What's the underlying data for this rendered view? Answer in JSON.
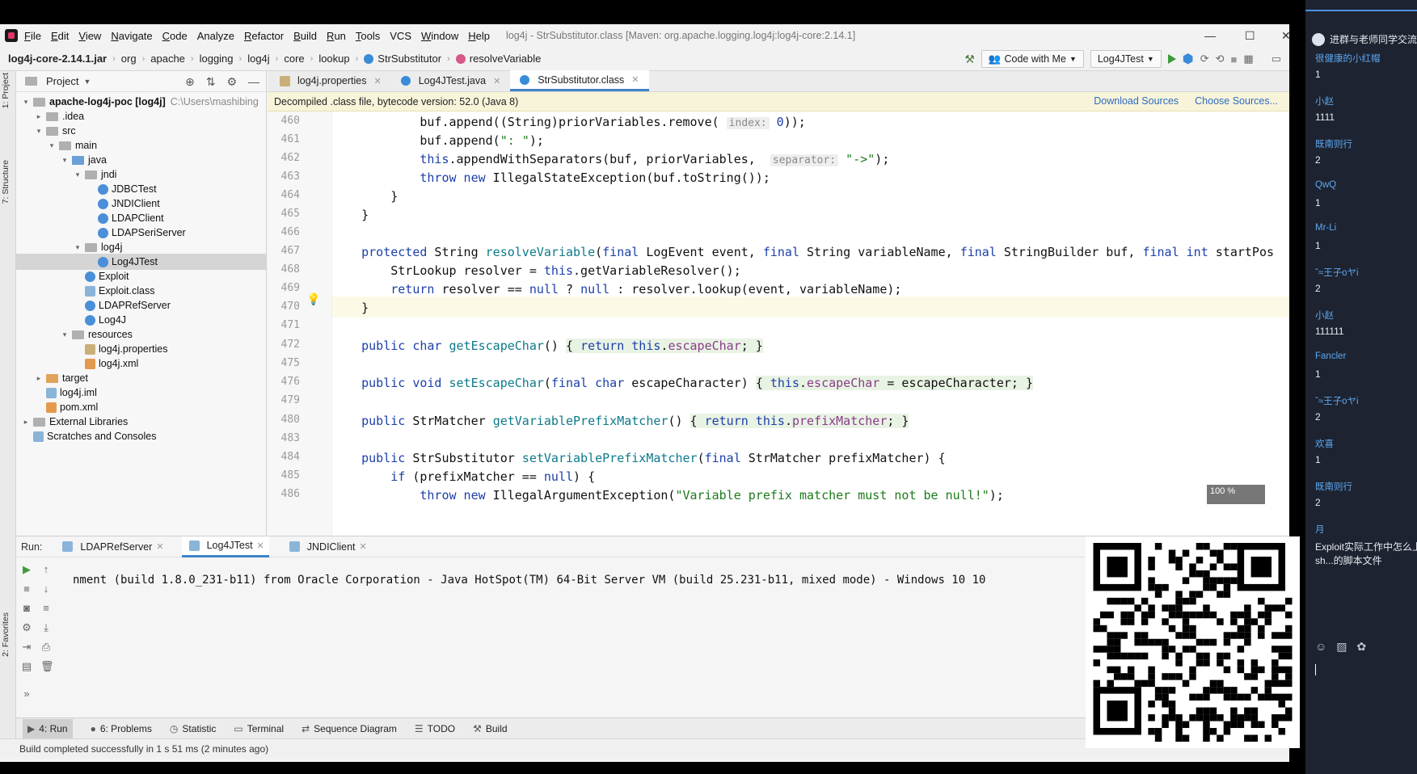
{
  "menu": {
    "items": [
      {
        "u": "F",
        "rest": "ile"
      },
      {
        "u": "E",
        "rest": "dit"
      },
      {
        "u": "V",
        "rest": "iew"
      },
      {
        "u": "N",
        "rest": "avigate"
      },
      {
        "u": "C",
        "rest": "ode"
      },
      {
        "u": "",
        "rest": "Analyze"
      },
      {
        "u": "R",
        "rest": "efactor"
      },
      {
        "u": "B",
        "rest": "uild"
      },
      {
        "u": "R",
        "rest": "un"
      },
      {
        "u": "T",
        "rest": "ools"
      },
      {
        "u": "",
        "rest": "VCS"
      },
      {
        "u": "W",
        "rest": "indow"
      },
      {
        "u": "H",
        "rest": "elp"
      }
    ],
    "window_title": "log4j - StrSubstitutor.class [Maven: org.apache.logging.log4j:log4j-core:2.14.1]"
  },
  "nav": {
    "crumbs": [
      "log4j-core-2.14.1.jar",
      "org",
      "apache",
      "logging",
      "log4j",
      "core",
      "lookup",
      "StrSubstitutor",
      "resolveVariable"
    ],
    "code_with_me": "Code with Me",
    "run_config": "Log4JTest"
  },
  "sidebar_tabs": {
    "project": "1: Project",
    "structure": "7: Structure",
    "favorites": "2: Favorites"
  },
  "project": {
    "title": "Project",
    "tree": [
      {
        "label": "apache-log4j-poc [log4j]",
        "extra": "C:\\Users\\mashibing",
        "indent": 0,
        "twisty": "▾",
        "icon": "fold gray",
        "bold": true
      },
      {
        "label": ".idea",
        "extra": "",
        "indent": 1,
        "twisty": "▸",
        "icon": "fold gray"
      },
      {
        "label": "src",
        "extra": "",
        "indent": 1,
        "twisty": "▾",
        "icon": "fold gray"
      },
      {
        "label": "main",
        "extra": "",
        "indent": 2,
        "twisty": "▾",
        "icon": "fold gray"
      },
      {
        "label": "java",
        "extra": "",
        "indent": 3,
        "twisty": "▾",
        "icon": "fold blue"
      },
      {
        "label": "jndi",
        "extra": "",
        "indent": 4,
        "twisty": "▾",
        "icon": "fold gray"
      },
      {
        "label": "JDBCTest",
        "extra": "",
        "indent": 5,
        "twisty": "",
        "icon": "ficon"
      },
      {
        "label": "JNDIClient",
        "extra": "",
        "indent": 5,
        "twisty": "",
        "icon": "ficon"
      },
      {
        "label": "LDAPClient",
        "extra": "",
        "indent": 5,
        "twisty": "",
        "icon": "ficon"
      },
      {
        "label": "LDAPSeriServer",
        "extra": "",
        "indent": 5,
        "twisty": "",
        "icon": "ficon"
      },
      {
        "label": "log4j",
        "extra": "",
        "indent": 4,
        "twisty": "▾",
        "icon": "fold gray"
      },
      {
        "label": "Log4JTest",
        "extra": "",
        "indent": 5,
        "twisty": "",
        "icon": "ficon",
        "selected": true
      },
      {
        "label": "Exploit",
        "extra": "",
        "indent": 4,
        "twisty": "",
        "icon": "ficon"
      },
      {
        "label": "Exploit.class",
        "extra": "",
        "indent": 4,
        "twisty": "",
        "icon": "ficon doc"
      },
      {
        "label": "LDAPRefServer",
        "extra": "",
        "indent": 4,
        "twisty": "",
        "icon": "ficon"
      },
      {
        "label": "Log4J",
        "extra": "",
        "indent": 4,
        "twisty": "",
        "icon": "ficon"
      },
      {
        "label": "resources",
        "extra": "",
        "indent": 3,
        "twisty": "▾",
        "icon": "fold gray"
      },
      {
        "label": "log4j.properties",
        "extra": "",
        "indent": 4,
        "twisty": "",
        "icon": "ficon prop"
      },
      {
        "label": "log4j.xml",
        "extra": "",
        "indent": 4,
        "twisty": "",
        "icon": "ficon xml"
      },
      {
        "label": "target",
        "extra": "",
        "indent": 1,
        "twisty": "▸",
        "icon": "fold orange"
      },
      {
        "label": "log4j.iml",
        "extra": "",
        "indent": 1,
        "twisty": "",
        "icon": "ficon doc"
      },
      {
        "label": "pom.xml",
        "extra": "",
        "indent": 1,
        "twisty": "",
        "icon": "ficon xml"
      },
      {
        "label": "External Libraries",
        "extra": "",
        "indent": 0,
        "twisty": "▸",
        "icon": "fold gray"
      },
      {
        "label": "Scratches and Consoles",
        "extra": "",
        "indent": 0,
        "twisty": "",
        "icon": "ficon doc"
      }
    ]
  },
  "editor": {
    "tabs": [
      {
        "label": "log4j.properties",
        "active": false
      },
      {
        "label": "Log4JTest.java",
        "active": false
      },
      {
        "label": "StrSubstitutor.class",
        "active": true
      }
    ],
    "banner": "Decompiled .class file, bytecode version: 52.0 (Java 8)",
    "download_sources": "Download Sources",
    "choose_sources": "Choose Sources...",
    "line_numbers": [
      "460",
      "461",
      "462",
      "463",
      "464",
      "465",
      "466",
      "467",
      "468",
      "469",
      "470",
      "471",
      "472",
      "475",
      "476",
      "479",
      "480",
      "483",
      "484",
      "485",
      "486"
    ],
    "zoom": "100 %"
  },
  "run": {
    "label": "Run:",
    "tabs": [
      {
        "label": "LDAPRefServer",
        "active": false
      },
      {
        "label": "Log4JTest",
        "active": true
      },
      {
        "label": "JNDIClient",
        "active": false
      }
    ],
    "console": "nment (build 1.8.0_231-b11) from Oracle Corporation - Java HotSpot(TM) 64-Bit Server VM (build 25.231-b11, mixed mode) - Windows 10 10"
  },
  "bottom_tools": [
    {
      "label": "4: Run",
      "selected": true
    },
    {
      "label": "6: Problems",
      "selected": false
    },
    {
      "label": "Statistic",
      "selected": false
    },
    {
      "label": "Terminal",
      "selected": false
    },
    {
      "label": "Sequence Diagram",
      "selected": false
    },
    {
      "label": "TODO",
      "selected": false
    },
    {
      "label": "Build",
      "selected": false
    }
  ],
  "status": "Build completed successfully in 1 s 51 ms (2 minutes ago)",
  "chat": {
    "header": "进群与老师同学交流",
    "messages": [
      {
        "name": "很健康的小红帽",
        "text": "1"
      },
      {
        "name": "小赵",
        "text": "1111"
      },
      {
        "name": "既南则行",
        "text": "2"
      },
      {
        "name": "QwQ",
        "text": "1"
      },
      {
        "name": "Mr-Li",
        "text": "1"
      },
      {
        "name": "ˇ≈王子oヤi",
        "text": "2"
      },
      {
        "name": "小赵",
        "text": "111111"
      },
      {
        "name": "Fancler",
        "text": "1"
      },
      {
        "name": "ˇ≈王子oヤi",
        "text": "2"
      },
      {
        "name": "欢喜",
        "text": "1"
      },
      {
        "name": "既南则行",
        "text": "2"
      },
      {
        "name": "月",
        "text": "Exploit实际工作中怎么上传",
        "text2": "sh...的脚本文件"
      }
    ]
  }
}
